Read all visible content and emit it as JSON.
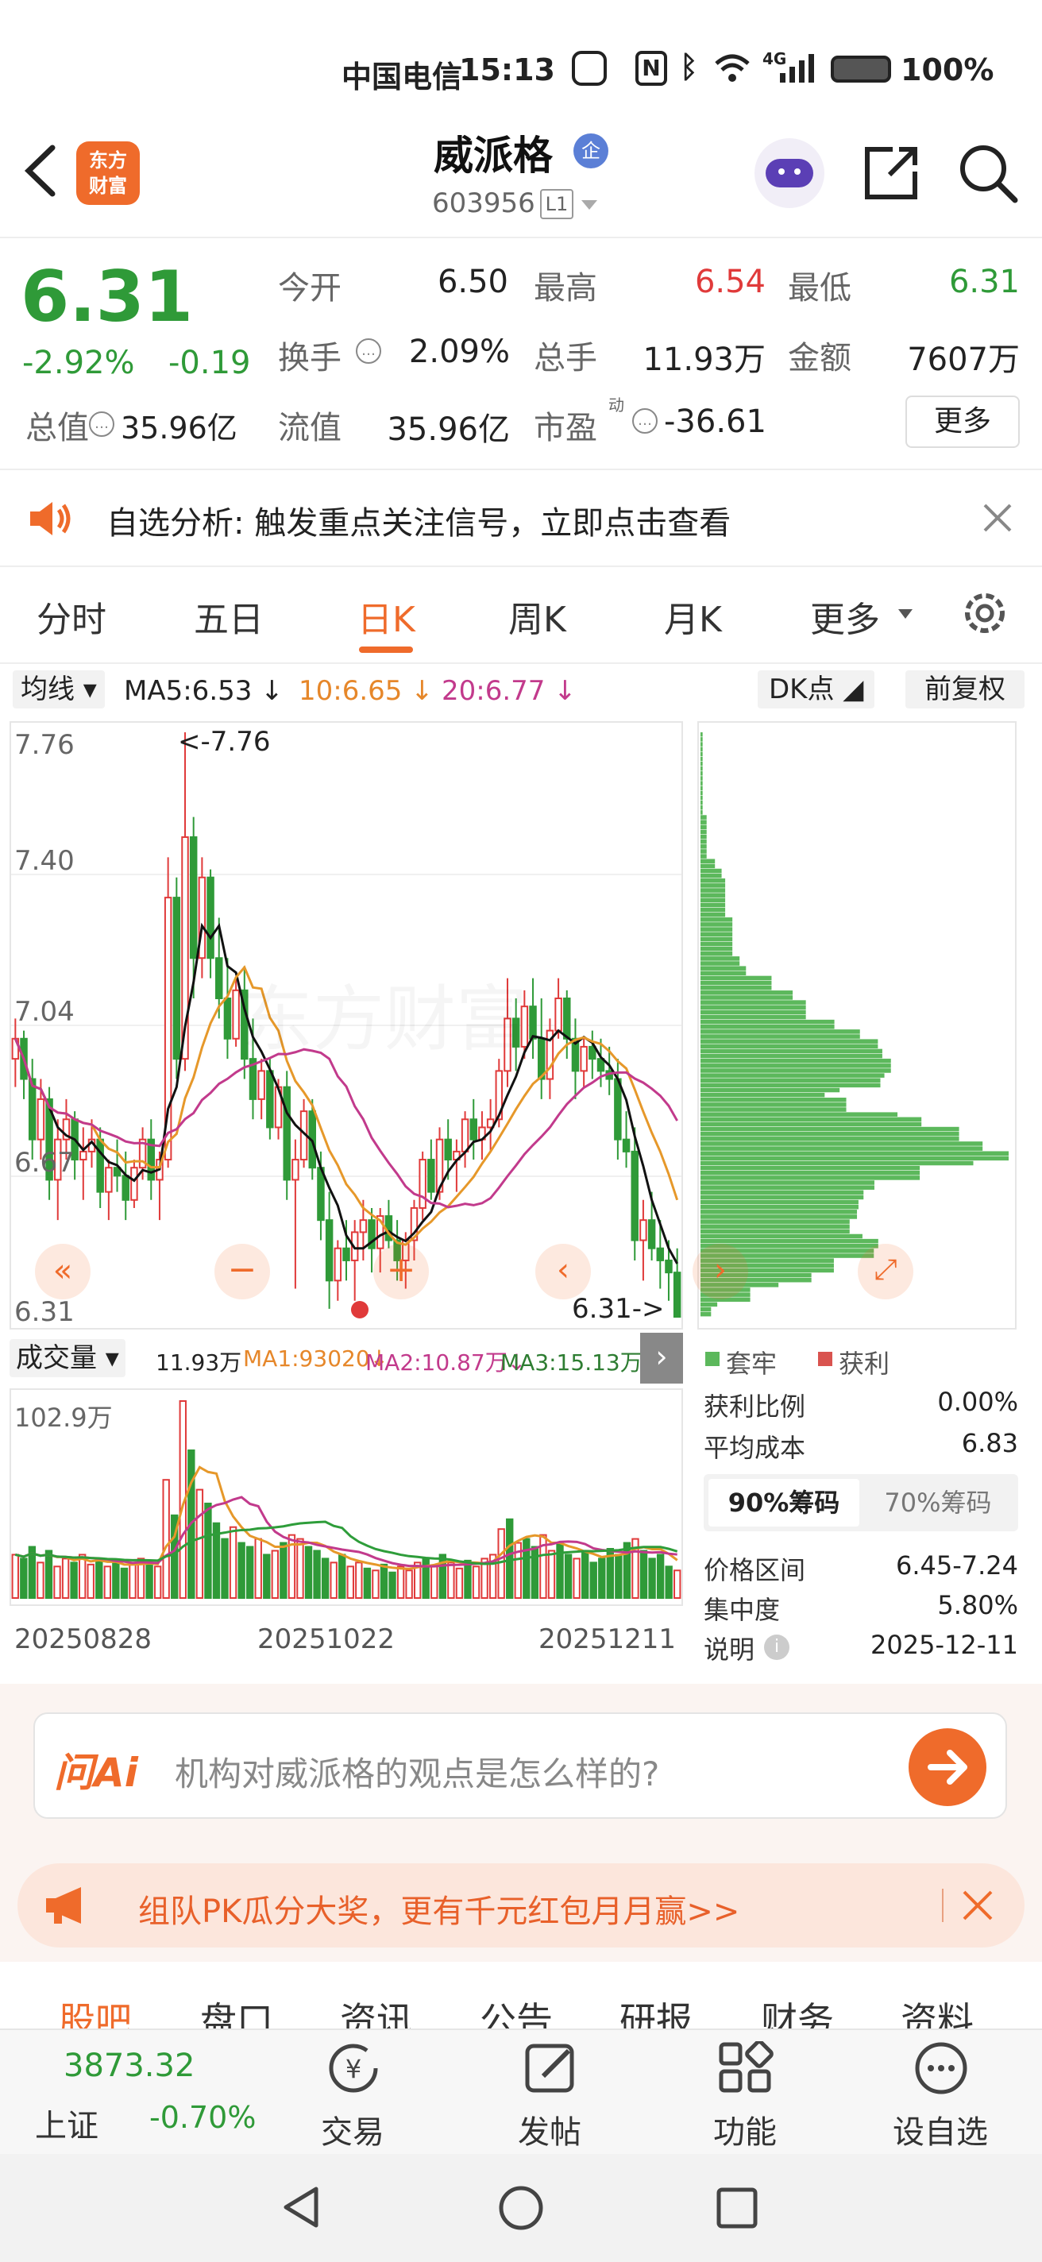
{
  "status_bar": {
    "carrier": "中国电信",
    "time": "15:13",
    "network": "4G",
    "battery": "100%"
  },
  "header": {
    "logo_line1": "东方",
    "logo_line2": "财富",
    "stock_name": "威派格",
    "badge": "企",
    "stock_code": "603956",
    "level": "L1"
  },
  "quote": {
    "price": "6.31",
    "change_pct": "-2.92%",
    "change_amt": "-0.19",
    "open_label": "今开",
    "open": "6.50",
    "high_label": "最高",
    "high": "6.54",
    "low_label": "最低",
    "low": "6.31",
    "turnover_label": "换手",
    "turnover": "2.09%",
    "volume_label": "总手",
    "volume": "11.93万",
    "amount_label": "金额",
    "amount": "7607万",
    "mktcap_label": "总值",
    "mktcap": "35.96亿",
    "float_label": "流值",
    "float_cap": "35.96亿",
    "pe_label": "市盈",
    "pe_sup": "动",
    "pe": "-36.61",
    "more": "更多"
  },
  "notice": {
    "text": "自选分析: 触发重点关注信号，立即点击查看"
  },
  "period_tabs": [
    "分时",
    "五日",
    "日K",
    "周K",
    "月K"
  ],
  "period_more": "更多",
  "ma_bar": {
    "selector": "均线",
    "ma5": "MA5:6.53",
    "ma10": "10:6.65",
    "ma20": "20:6.77",
    "dk": "DK点",
    "adjust": "前复权"
  },
  "kline": {
    "price_labels": [
      "7.76",
      "7.40",
      "7.04",
      "6.67",
      "6.31"
    ],
    "max_note": "<-7.76",
    "last_note": "6.31->",
    "watermark": "东方财富",
    "y_max": 7.76,
    "y_min": 6.31,
    "candles": [
      [
        6.95,
        7.05,
        6.88,
        7.0
      ],
      [
        7.0,
        7.02,
        6.85,
        6.9
      ],
      [
        6.9,
        6.95,
        6.7,
        6.75
      ],
      [
        6.75,
        6.9,
        6.7,
        6.85
      ],
      [
        6.85,
        6.88,
        6.6,
        6.65
      ],
      [
        6.65,
        6.8,
        6.55,
        6.75
      ],
      [
        6.75,
        6.85,
        6.7,
        6.8
      ],
      [
        6.8,
        6.82,
        6.65,
        6.7
      ],
      [
        6.7,
        6.78,
        6.6,
        6.72
      ],
      [
        6.72,
        6.8,
        6.68,
        6.75
      ],
      [
        6.75,
        6.78,
        6.58,
        6.62
      ],
      [
        6.62,
        6.7,
        6.55,
        6.68
      ],
      [
        6.68,
        6.75,
        6.62,
        6.66
      ],
      [
        6.66,
        6.72,
        6.55,
        6.6
      ],
      [
        6.6,
        6.7,
        6.58,
        6.68
      ],
      [
        6.68,
        6.78,
        6.65,
        6.75
      ],
      [
        6.75,
        6.8,
        6.6,
        6.65
      ],
      [
        6.65,
        6.72,
        6.55,
        6.7
      ],
      [
        6.7,
        7.45,
        6.68,
        7.35
      ],
      [
        7.35,
        7.4,
        6.9,
        6.95
      ],
      [
        6.95,
        7.76,
        6.92,
        7.5
      ],
      [
        7.5,
        7.55,
        7.1,
        7.2
      ],
      [
        7.2,
        7.45,
        7.15,
        7.4
      ],
      [
        7.4,
        7.42,
        7.15,
        7.2
      ],
      [
        7.2,
        7.3,
        7.05,
        7.1
      ],
      [
        7.1,
        7.2,
        6.95,
        7.0
      ],
      [
        7.0,
        7.15,
        6.98,
        7.12
      ],
      [
        7.12,
        7.18,
        6.9,
        6.95
      ],
      [
        6.95,
        7.05,
        6.8,
        6.85
      ],
      [
        6.85,
        6.95,
        6.8,
        6.92
      ],
      [
        6.92,
        6.95,
        6.75,
        6.78
      ],
      [
        6.78,
        6.9,
        6.75,
        6.88
      ],
      [
        6.88,
        6.92,
        6.6,
        6.65
      ],
      [
        6.65,
        6.75,
        6.38,
        6.7
      ],
      [
        6.7,
        6.85,
        6.68,
        6.82
      ],
      [
        6.82,
        6.85,
        6.65,
        6.68
      ],
      [
        6.68,
        6.72,
        6.5,
        6.55
      ],
      [
        6.55,
        6.62,
        6.33,
        6.4
      ],
      [
        6.4,
        6.5,
        6.35,
        6.48
      ],
      [
        6.48,
        6.55,
        6.4,
        6.45
      ],
      [
        6.45,
        6.55,
        6.35,
        6.52
      ],
      [
        6.52,
        6.6,
        6.45,
        6.55
      ],
      [
        6.55,
        6.58,
        6.42,
        6.48
      ],
      [
        6.48,
        6.58,
        6.42,
        6.56
      ],
      [
        6.56,
        6.6,
        6.48,
        6.5
      ],
      [
        6.5,
        6.55,
        6.4,
        6.45
      ],
      [
        6.45,
        6.52,
        6.38,
        6.5
      ],
      [
        6.5,
        6.6,
        6.45,
        6.58
      ],
      [
        6.58,
        6.72,
        6.55,
        6.7
      ],
      [
        6.7,
        6.75,
        6.6,
        6.62
      ],
      [
        6.62,
        6.78,
        6.6,
        6.75
      ],
      [
        6.75,
        6.8,
        6.65,
        6.7
      ],
      [
        6.7,
        6.75,
        6.62,
        6.72
      ],
      [
        6.72,
        6.82,
        6.68,
        6.8
      ],
      [
        6.8,
        6.85,
        6.7,
        6.75
      ],
      [
        6.75,
        6.82,
        6.7,
        6.78
      ],
      [
        6.78,
        6.85,
        6.72,
        6.8
      ],
      [
        6.8,
        6.95,
        6.78,
        6.92
      ],
      [
        6.92,
        7.15,
        6.88,
        7.05
      ],
      [
        7.05,
        7.1,
        6.92,
        6.98
      ],
      [
        6.98,
        7.12,
        6.95,
        7.08
      ],
      [
        7.08,
        7.15,
        6.95,
        7.0
      ],
      [
        7.0,
        7.1,
        6.85,
        6.9
      ],
      [
        6.9,
        7.05,
        6.85,
        7.02
      ],
      [
        7.02,
        7.15,
        7.0,
        7.1
      ],
      [
        7.1,
        7.12,
        6.95,
        7.0
      ],
      [
        7.0,
        7.05,
        6.85,
        6.92
      ],
      [
        6.92,
        7.0,
        6.88,
        6.98
      ],
      [
        6.98,
        7.02,
        6.9,
        6.95
      ],
      [
        6.95,
        7.0,
        6.88,
        6.92
      ],
      [
        6.92,
        6.98,
        6.86,
        6.9
      ],
      [
        6.9,
        6.95,
        6.7,
        6.75
      ],
      [
        6.75,
        6.82,
        6.68,
        6.72
      ],
      [
        6.72,
        6.78,
        6.45,
        6.5
      ],
      [
        6.5,
        6.6,
        6.4,
        6.55
      ],
      [
        6.55,
        6.62,
        6.45,
        6.48
      ],
      [
        6.48,
        6.55,
        6.38,
        6.45
      ],
      [
        6.45,
        6.5,
        6.35,
        6.42
      ],
      [
        6.42,
        6.48,
        6.31,
        6.31
      ]
    ]
  },
  "volume": {
    "selector": "成交量",
    "value": "11.93万",
    "ma1": "MA1:93020",
    "ma2": "MA2:10.87万",
    "ma3": "MA3:15.13万",
    "max_label": "102.9万",
    "dates": [
      "20250828",
      "20251022",
      "20251211"
    ],
    "bars": [
      22,
      20,
      26,
      18,
      24,
      16,
      20,
      18,
      22,
      17,
      19,
      16,
      18,
      15,
      17,
      20,
      18,
      16,
      60,
      42,
      100,
      75,
      55,
      48,
      38,
      30,
      36,
      28,
      26,
      30,
      22,
      24,
      28,
      32,
      30,
      26,
      24,
      20,
      18,
      22,
      16,
      18,
      15,
      14,
      17,
      13,
      16,
      14,
      18,
      20,
      16,
      22,
      18,
      15,
      19,
      16,
      20,
      22,
      35,
      40,
      28,
      30,
      26,
      32,
      24,
      28,
      22,
      20,
      24,
      18,
      20,
      25,
      22,
      28,
      30,
      24,
      20,
      22,
      16,
      14
    ]
  },
  "chips": {
    "legend_lock": "套牢",
    "legend_profit": "获利",
    "profit_ratio_label": "获利比例",
    "profit_ratio": "0.00%",
    "avg_cost_label": "平均成本",
    "avg_cost": "6.83",
    "tab90": "90%筹码",
    "tab70": "70%筹码",
    "range_label": "价格区间",
    "range": "6.45-7.24",
    "concentration_label": "集中度",
    "concentration": "5.80%",
    "note_label": "说明",
    "note_date": "2025-12-11"
  },
  "ai_box": {
    "label": "问Ai",
    "placeholder": "机构对威派格的观点是怎么样的?"
  },
  "promo": {
    "text": "组队PK瓜分大奖，更有千元红包月月赢>>"
  },
  "sub_tabs": [
    "股吧",
    "盘口",
    "资讯",
    "公告",
    "研报",
    "财务",
    "资料"
  ],
  "bottom_nav": {
    "index_value": "3873.32",
    "index_name": "上证",
    "index_change": "-0.70%",
    "items": [
      "交易",
      "发帖",
      "功能",
      "设自选"
    ]
  }
}
